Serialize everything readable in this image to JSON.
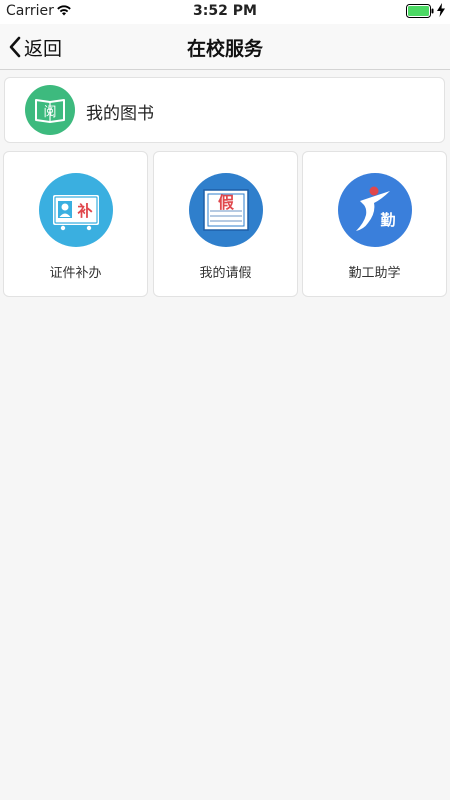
{
  "status_bar": {
    "carrier": "Carrier",
    "time": "3:52 PM",
    "wifi_icon": "wifi-icon",
    "battery_icon": "battery-icon",
    "charging_icon": "bolt-icon"
  },
  "nav": {
    "back_label": "返回",
    "back_icon": "chevron-left-icon",
    "title": "在校服务"
  },
  "books": {
    "icon_text": "阅",
    "label": "我的图书",
    "icon_color": "#3dba7e"
  },
  "services": [
    {
      "label": "证件补办",
      "icon_text": "补",
      "icon": "id-card-icon",
      "color": "#3aafe0"
    },
    {
      "label": "我的请假",
      "icon_text": "假",
      "icon": "leave-note-icon",
      "color": "#2f7fcc"
    },
    {
      "label": "勤工助学",
      "icon_text": "勤",
      "icon": "work-study-icon",
      "color": "#3a7fdb"
    }
  ],
  "colors": {
    "background": "#f6f6f6",
    "card": "#ffffff",
    "accent_red": "#e0474c"
  }
}
